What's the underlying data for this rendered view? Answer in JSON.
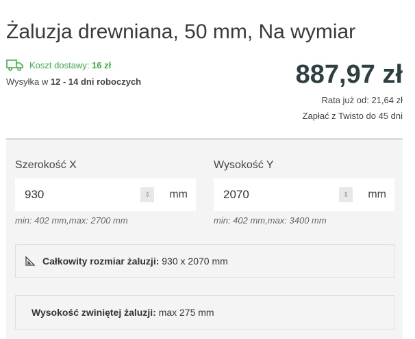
{
  "title": "Żaluzja drewniana, 50 mm, Na wymiar",
  "shipping": {
    "cost_label": "Koszt dostawy:",
    "cost": "16 zł",
    "dispatch_prefix": "Wysyłka w",
    "dispatch_time": "12 - 14 dni roboczych"
  },
  "price": {
    "value": "887,97 zł",
    "installment": "Rata już od: 21,64 zł",
    "twisto": "Zapłać z Twisto do 45 dni"
  },
  "width": {
    "label": "Szerokość X",
    "value": "930",
    "unit": "mm",
    "hint": "min: 402 mm,max: 2700 mm"
  },
  "height": {
    "label": "Wysokość Y",
    "value": "2070",
    "unit": "mm",
    "hint": "min: 402 mm,max: 3400 mm"
  },
  "total": {
    "label": "Całkowity rozmiar żaluzji:",
    "value": "930 x 2070 mm"
  },
  "rolled": {
    "label": "Wysokość zwiniętej żaluzji:",
    "value": "max 275 mm"
  }
}
